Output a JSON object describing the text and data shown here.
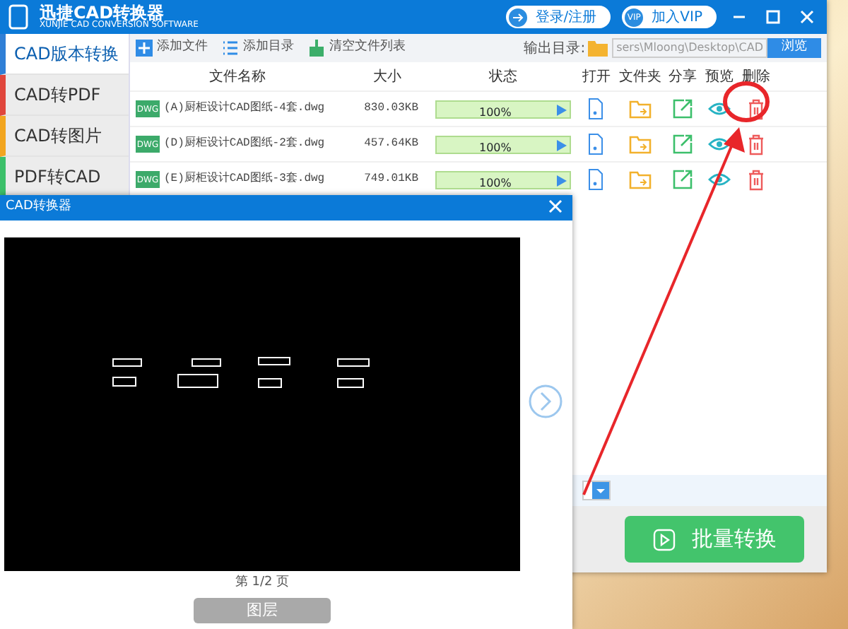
{
  "app": {
    "title": "迅捷CAD转换器",
    "subtitle": "XUNJIE CAD CONVERSION SOFTWARE",
    "login_button": "登录/注册",
    "vip_button": "加入VIP",
    "vip_badge": "VIP"
  },
  "sidebar": {
    "items": [
      {
        "label": "CAD版本转换",
        "selected": true,
        "color": "#2f7fd6"
      },
      {
        "label": "CAD转PDF",
        "selected": false,
        "color": "#e0463c"
      },
      {
        "label": "CAD转图片",
        "selected": false,
        "color": "#f2a51f"
      },
      {
        "label": "PDF转CAD",
        "selected": false,
        "color": "#3cc06a"
      }
    ]
  },
  "toolbar": {
    "add_file": "添加文件",
    "add_folder": "添加目录",
    "clear_list": "清空文件列表",
    "output_label": "输出目录:",
    "output_path": "sers\\Mloong\\Desktop\\CAD",
    "browse_button": "浏览"
  },
  "table": {
    "columns": [
      "文件名称",
      "大小",
      "状态",
      "打开",
      "文件夹",
      "分享",
      "预览",
      "删除"
    ],
    "rows": [
      {
        "type_label": "DWG",
        "name": "(A)厨柜设计CAD图纸-4套.dwg",
        "size": "830.03KB",
        "level": 1,
        "status": "100%"
      },
      {
        "type_label": "DWG",
        "name": "(D)厨柜设计CAD图纸-2套.dwg",
        "size": "457.64KB",
        "level": 1,
        "status": "100%"
      },
      {
        "type_label": "DWG",
        "name": "(E)厨柜设计CAD图纸-3套.dwg",
        "size": "749.01KB",
        "level": 1,
        "status": "100%"
      }
    ]
  },
  "batch_button": "批量转换",
  "preview_dialog": {
    "title": "CAD转换器",
    "page_indicator": "第 1/2 页",
    "layer_button": "图层"
  }
}
